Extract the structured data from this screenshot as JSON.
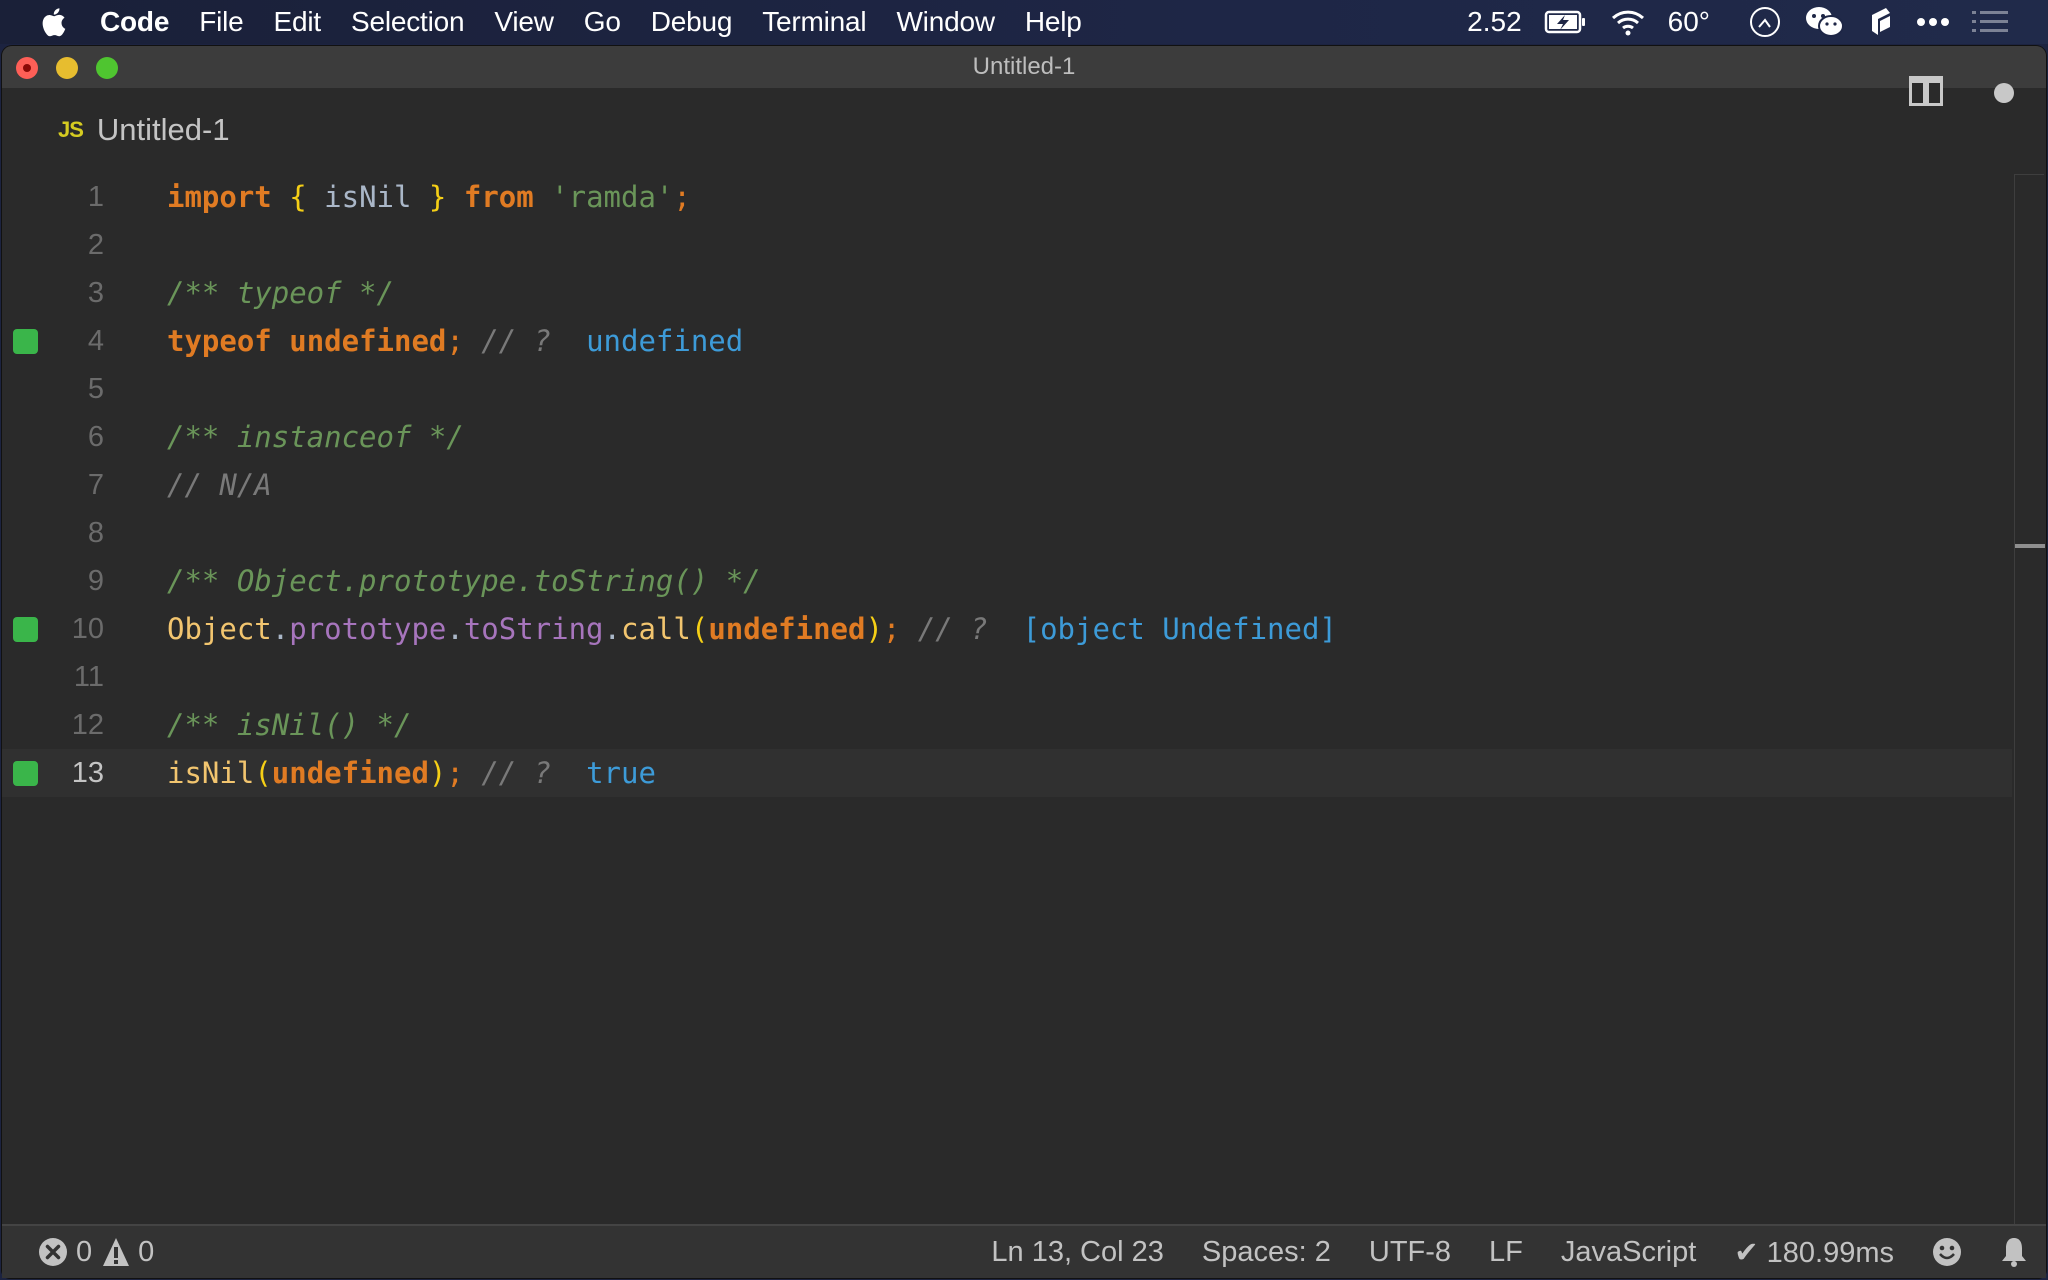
{
  "menubar": {
    "app_name": "Code",
    "items": [
      "File",
      "Edit",
      "Selection",
      "View",
      "Go",
      "Debug",
      "Terminal",
      "Window",
      "Help"
    ],
    "status": {
      "load_average": "2.52",
      "temperature": "60°"
    },
    "icons": [
      "apple-icon",
      "battery-charging-icon",
      "wifi-icon",
      "clock-icon",
      "wechat-icon",
      "app-icon",
      "more-icon",
      "notification-list-icon"
    ]
  },
  "window": {
    "title": "Untitled-1"
  },
  "tab": {
    "icon_label": "JS",
    "label": "Untitled-1"
  },
  "editor": {
    "lines": [
      {
        "number": "1",
        "marker": false,
        "current": false,
        "tokens": [
          {
            "t": "import",
            "c": "keyword"
          },
          {
            "t": " ",
            "c": "ident"
          },
          {
            "t": "{",
            "c": "brace"
          },
          {
            "t": " isNil ",
            "c": "ident"
          },
          {
            "t": "}",
            "c": "brace"
          },
          {
            "t": " ",
            "c": "ident"
          },
          {
            "t": "from",
            "c": "keyword"
          },
          {
            "t": " ",
            "c": "ident"
          },
          {
            "t": "'ramda'",
            "c": "string"
          },
          {
            "t": ";",
            "c": "punct"
          }
        ]
      },
      {
        "number": "2",
        "marker": false,
        "current": false,
        "tokens": []
      },
      {
        "number": "3",
        "marker": false,
        "current": false,
        "tokens": [
          {
            "t": "/** typeof */",
            "c": "comment"
          }
        ]
      },
      {
        "number": "4",
        "marker": true,
        "current": false,
        "tokens": [
          {
            "t": "typeof",
            "c": "keyword"
          },
          {
            "t": " ",
            "c": "ident"
          },
          {
            "t": "undefined",
            "c": "undef"
          },
          {
            "t": ";",
            "c": "punct"
          },
          {
            "t": " // ? ",
            "c": "comment-gray"
          },
          {
            "t": " undefined",
            "c": "result"
          }
        ]
      },
      {
        "number": "5",
        "marker": false,
        "current": false,
        "tokens": []
      },
      {
        "number": "6",
        "marker": false,
        "current": false,
        "tokens": [
          {
            "t": "/** instanceof */",
            "c": "comment"
          }
        ]
      },
      {
        "number": "7",
        "marker": false,
        "current": false,
        "tokens": [
          {
            "t": "// N/A",
            "c": "comment-gray"
          }
        ]
      },
      {
        "number": "8",
        "marker": false,
        "current": false,
        "tokens": []
      },
      {
        "number": "9",
        "marker": false,
        "current": false,
        "tokens": [
          {
            "t": "/** Object.prototype.toString() */",
            "c": "comment"
          }
        ]
      },
      {
        "number": "10",
        "marker": true,
        "current": false,
        "tokens": [
          {
            "t": "Object",
            "c": "object"
          },
          {
            "t": ".",
            "c": "dot"
          },
          {
            "t": "prototype",
            "c": "prop"
          },
          {
            "t": ".",
            "c": "dot"
          },
          {
            "t": "toString",
            "c": "prop"
          },
          {
            "t": ".",
            "c": "dot"
          },
          {
            "t": "call",
            "c": "method"
          },
          {
            "t": "(",
            "c": "brace"
          },
          {
            "t": "undefined",
            "c": "undef"
          },
          {
            "t": ")",
            "c": "brace"
          },
          {
            "t": ";",
            "c": "punct"
          },
          {
            "t": " // ? ",
            "c": "comment-gray"
          },
          {
            "t": " [object Undefined]",
            "c": "result"
          }
        ]
      },
      {
        "number": "11",
        "marker": false,
        "current": false,
        "tokens": []
      },
      {
        "number": "12",
        "marker": false,
        "current": false,
        "tokens": [
          {
            "t": "/** isNil() */",
            "c": "comment"
          }
        ]
      },
      {
        "number": "13",
        "marker": true,
        "current": true,
        "tokens": [
          {
            "t": "isNil",
            "c": "method"
          },
          {
            "t": "(",
            "c": "brace"
          },
          {
            "t": "undefined",
            "c": "undef"
          },
          {
            "t": ")",
            "c": "brace"
          },
          {
            "t": ";",
            "c": "punct"
          },
          {
            "t": " // ? ",
            "c": "comment-gray"
          },
          {
            "t": " true",
            "c": "result"
          }
        ]
      }
    ]
  },
  "statusbar": {
    "errors": "0",
    "warnings": "0",
    "cursor_position": "Ln 13, Col 23",
    "indentation": "Spaces: 2",
    "encoding": "UTF-8",
    "line_ending": "LF",
    "language": "JavaScript",
    "timing": "✔ 180.99ms"
  },
  "colors": {
    "keyword": "#e07b23",
    "comment": "#6a9559",
    "result": "#3d9bd8",
    "property": "#a775bd",
    "brace": "#f5cf16",
    "coverage_marker": "#3ab54a"
  }
}
